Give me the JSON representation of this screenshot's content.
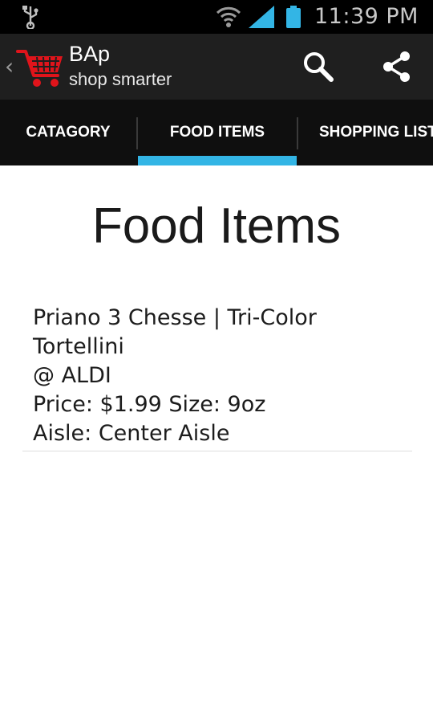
{
  "status_bar": {
    "time": "11:39 PM",
    "icons": [
      "usb-icon",
      "wifi-icon",
      "signal-icon",
      "battery-icon"
    ]
  },
  "action_bar": {
    "title": "BAp",
    "subtitle": "shop smarter",
    "icons": [
      "up-chevron-icon",
      "shopping-cart-logo",
      "search-icon",
      "share-icon"
    ]
  },
  "tabs": [
    {
      "label": "CATAGORY",
      "selected": false
    },
    {
      "label": "FOOD ITEMS",
      "selected": true
    },
    {
      "label": "SHOPPING LIST",
      "selected": false
    }
  ],
  "colors": {
    "tab_indicator": "#33b5e5",
    "logo": "#e0141b",
    "action_bar_bg": "#1f1f1f",
    "tab_bar_bg": "#0f0f0f"
  },
  "page": {
    "title": "Food Items"
  },
  "food_items": [
    {
      "name": "Priano 3 Chesse | Tri-Color Tortellini",
      "store": "@ ALDI",
      "price_line": "Price: $1.99 Size: 9oz",
      "aisle_line": "Aisle: Center Aisle"
    }
  ]
}
